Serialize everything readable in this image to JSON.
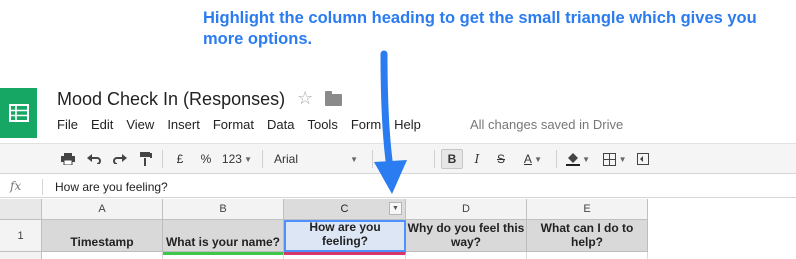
{
  "annotation": {
    "text": "Highlight the column heading to get the small triangle which gives you more options."
  },
  "app": {
    "title": "Mood Check In (Responses)",
    "icons": {
      "logo": "sheets-logo-icon",
      "star": "star-icon",
      "folder": "folder-icon"
    },
    "brand_color": "#16a765"
  },
  "menu": {
    "items": [
      "File",
      "Edit",
      "View",
      "Insert",
      "Format",
      "Data",
      "Tools",
      "Form",
      "Help"
    ],
    "status": "All changes saved in Drive"
  },
  "toolbar": {
    "currency": "£",
    "percent": "%",
    "number_format": "123",
    "font": "Arial",
    "bold": "B",
    "italic": "I",
    "strike": "S",
    "text_color": "A"
  },
  "formula_bar": {
    "fx": "fx",
    "value": "How are you feeling?"
  },
  "grid": {
    "columns": [
      "A",
      "B",
      "C",
      "D",
      "E"
    ],
    "selected_column": "C",
    "rows": [
      {
        "number": "1",
        "cells": [
          "Timestamp",
          "What is your name?",
          "How are you feeling?",
          "Why do you feel this way?",
          "What can I do to help?"
        ]
      }
    ],
    "colors": {
      "selection": "#4d90fe",
      "arrow": "#2a7cf0"
    }
  }
}
